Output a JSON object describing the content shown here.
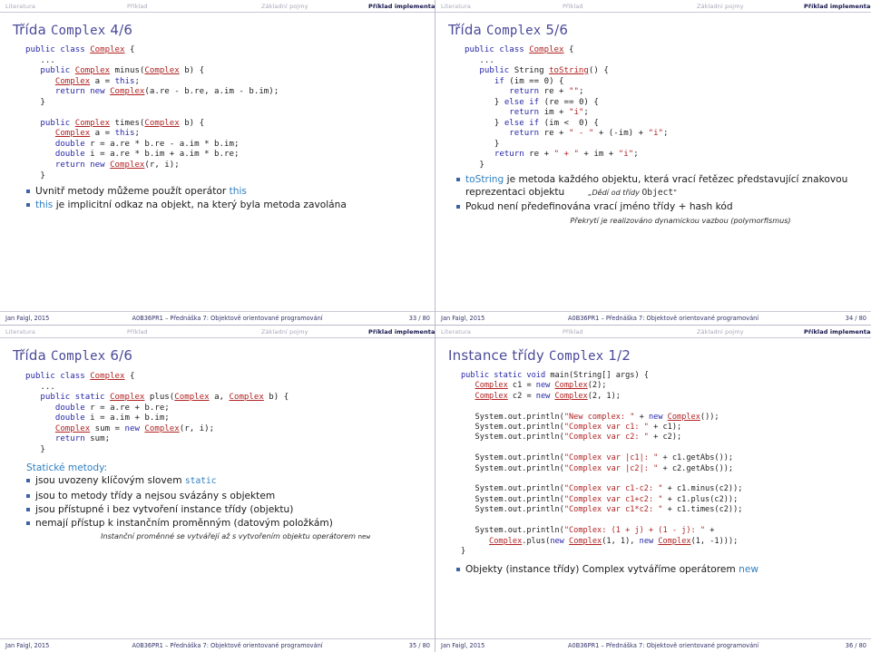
{
  "theme": {
    "title_color": "#4a4a99",
    "nav_inactive": "#a8a8bb",
    "nav_active": "#11114a",
    "keyword_color": "#2727a8",
    "class_color": "#b22222",
    "string_color": "#b22222",
    "bullet_color": "#3c63a8",
    "highlight_color": "#2f7fc1",
    "footer_color": "#33336b"
  },
  "nav": {
    "items": [
      {
        "label": "Literatura",
        "active": false
      },
      {
        "label": "Příklad",
        "active": false
      },
      {
        "label": "Základní pojmy",
        "active": false
      },
      {
        "label": "Příklad implementace",
        "active": true
      }
    ]
  },
  "footer_common": {
    "author": "Jan Faigl, 2015",
    "center": "A0B36PR1 – Přednáška 7: Objektově orientované programování"
  },
  "slides": [
    {
      "id": "slide-33",
      "title_text": "Třída ",
      "title_mono": "Complex",
      "title_suffix": " 4/6",
      "page": "33 / 80",
      "bullets": [
        {
          "pre": "Uvnitř metody můžeme použít operátor ",
          "hl": "this",
          "post": ""
        },
        {
          "pre": "",
          "hl": "this",
          "post": " je implicitní odkaz na objekt, na který byla metoda zavolána"
        }
      ]
    },
    {
      "id": "slide-34",
      "title_text": "Třída ",
      "title_mono": "Complex",
      "title_suffix": " 5/6",
      "page": "34 / 80",
      "bullets": [
        {
          "pre": "",
          "hl": "toString",
          "post": " je metoda každého objektu, která vrací řetězec představující znakovou reprezentaci objektu"
        },
        {
          "pre": "Pokud není předefinována vrací jméno třídy + hash kód",
          "hl": "",
          "post": ""
        }
      ],
      "side_note_text": "„Dědí od třídy ",
      "side_note_mono": "Object",
      "side_note_suffix": "\"",
      "bottom_note": "Překrytí je realizováno dynamickou vazbou (polymorfismus)"
    },
    {
      "id": "slide-35",
      "title_text": "Třída ",
      "title_mono": "Complex",
      "title_suffix": " 6/6",
      "page": "35 / 80",
      "lead": "Statické metody:",
      "bullets": [
        {
          "pre": "jsou uvozeny klíčovým slovem ",
          "hl": "static",
          "post": ""
        },
        {
          "pre": "jsou to metody třídy a nejsou svázány s objektem",
          "hl": "",
          "post": ""
        },
        {
          "pre": "jsou přístupné i bez vytvoření instance třídy (objektu)",
          "hl": "",
          "post": ""
        },
        {
          "pre": "nemají přístup k instančním proměnným (datovým položkám)",
          "hl": "",
          "post": ""
        }
      ],
      "bottom_note_text": "Instanční proměnné se vytvářejí až s vytvořením objektu operátorem ",
      "bottom_note_mono": "new"
    },
    {
      "id": "slide-36",
      "title_text": "Instance třídy ",
      "title_mono": "Complex",
      "title_suffix": " 1/2",
      "page": "36 / 80",
      "bullets": [
        {
          "pre": "Objekty (instance třídy) Complex vytváříme operátorem ",
          "hl": "new",
          "post": ""
        }
      ]
    }
  ],
  "code": {
    "slide33": [
      {
        "t": "public class ",
        "c": "kw"
      },
      {
        "t": "Complex",
        "c": "cls"
      },
      {
        "t": " {\n",
        "c": ""
      },
      {
        "t": "   ...\n",
        "c": ""
      },
      {
        "t": "   public ",
        "c": "kw"
      },
      {
        "t": "Complex",
        "c": "cls"
      },
      {
        "t": " minus(",
        "c": ""
      },
      {
        "t": "Complex",
        "c": "cls"
      },
      {
        "t": " b) {\n",
        "c": ""
      },
      {
        "t": "      ",
        "c": ""
      },
      {
        "t": "Complex",
        "c": "cls"
      },
      {
        "t": " a = ",
        "c": ""
      },
      {
        "t": "this",
        "c": "kw"
      },
      {
        "t": ";\n",
        "c": ""
      },
      {
        "t": "      return new ",
        "c": "kw"
      },
      {
        "t": "Complex",
        "c": "cls"
      },
      {
        "t": "(a.re - b.re, a.im - b.im);\n",
        "c": ""
      },
      {
        "t": "   }\n\n",
        "c": ""
      },
      {
        "t": "   public ",
        "c": "kw"
      },
      {
        "t": "Complex",
        "c": "cls"
      },
      {
        "t": " times(",
        "c": ""
      },
      {
        "t": "Complex",
        "c": "cls"
      },
      {
        "t": " b) {\n",
        "c": ""
      },
      {
        "t": "      ",
        "c": ""
      },
      {
        "t": "Complex",
        "c": "cls"
      },
      {
        "t": " a = ",
        "c": ""
      },
      {
        "t": "this",
        "c": "kw"
      },
      {
        "t": ";\n",
        "c": ""
      },
      {
        "t": "      double",
        "c": "kw"
      },
      {
        "t": " r = a.re * b.re - a.im * b.im;\n",
        "c": ""
      },
      {
        "t": "      double",
        "c": "kw"
      },
      {
        "t": " i = a.re * b.im + a.im * b.re;\n",
        "c": ""
      },
      {
        "t": "      return new ",
        "c": "kw"
      },
      {
        "t": "Complex",
        "c": "cls"
      },
      {
        "t": "(r, i);\n",
        "c": ""
      },
      {
        "t": "   }",
        "c": ""
      }
    ],
    "slide34": [
      {
        "t": "public class ",
        "c": "kw"
      },
      {
        "t": "Complex",
        "c": "cls"
      },
      {
        "t": " {\n",
        "c": ""
      },
      {
        "t": "   ...\n",
        "c": ""
      },
      {
        "t": "   public ",
        "c": "kw"
      },
      {
        "t": "String ",
        "c": ""
      },
      {
        "t": "toString",
        "c": "cls"
      },
      {
        "t": "() {\n",
        "c": ""
      },
      {
        "t": "      if",
        "c": "kw"
      },
      {
        "t": " (im == 0) {\n",
        "c": ""
      },
      {
        "t": "         return",
        "c": "kw"
      },
      {
        "t": " re + ",
        "c": ""
      },
      {
        "t": "\"\"",
        "c": "str"
      },
      {
        "t": ";\n",
        "c": ""
      },
      {
        "t": "      } ",
        "c": ""
      },
      {
        "t": "else if",
        "c": "kw"
      },
      {
        "t": " (re == 0) {\n",
        "c": ""
      },
      {
        "t": "         return",
        "c": "kw"
      },
      {
        "t": " im + ",
        "c": ""
      },
      {
        "t": "\"i\"",
        "c": "str"
      },
      {
        "t": ";\n",
        "c": ""
      },
      {
        "t": "      } ",
        "c": ""
      },
      {
        "t": "else if",
        "c": "kw"
      },
      {
        "t": " (im <  0) {\n",
        "c": ""
      },
      {
        "t": "         return",
        "c": "kw"
      },
      {
        "t": " re + ",
        "c": ""
      },
      {
        "t": "\" - \"",
        "c": "str"
      },
      {
        "t": " + (-im) + ",
        "c": ""
      },
      {
        "t": "\"i\"",
        "c": "str"
      },
      {
        "t": ";\n",
        "c": ""
      },
      {
        "t": "      }\n",
        "c": ""
      },
      {
        "t": "      return",
        "c": "kw"
      },
      {
        "t": " re + ",
        "c": ""
      },
      {
        "t": "\" + \"",
        "c": "str"
      },
      {
        "t": " + im + ",
        "c": ""
      },
      {
        "t": "\"i\"",
        "c": "str"
      },
      {
        "t": ";\n",
        "c": ""
      },
      {
        "t": "   }",
        "c": ""
      }
    ],
    "slide35": [
      {
        "t": "public class ",
        "c": "kw"
      },
      {
        "t": "Complex",
        "c": "cls"
      },
      {
        "t": " {\n",
        "c": ""
      },
      {
        "t": "   ...\n",
        "c": ""
      },
      {
        "t": "   public static ",
        "c": "kw"
      },
      {
        "t": "Complex",
        "c": "cls"
      },
      {
        "t": " plus(",
        "c": ""
      },
      {
        "t": "Complex",
        "c": "cls"
      },
      {
        "t": " a, ",
        "c": ""
      },
      {
        "t": "Complex",
        "c": "cls"
      },
      {
        "t": " b) {\n",
        "c": ""
      },
      {
        "t": "      double",
        "c": "kw"
      },
      {
        "t": " r = a.re + b.re;\n",
        "c": ""
      },
      {
        "t": "      double",
        "c": "kw"
      },
      {
        "t": " i = a.im + b.im;\n",
        "c": ""
      },
      {
        "t": "      ",
        "c": ""
      },
      {
        "t": "Complex",
        "c": "cls"
      },
      {
        "t": " sum = ",
        "c": ""
      },
      {
        "t": "new ",
        "c": "kw"
      },
      {
        "t": "Complex",
        "c": "cls"
      },
      {
        "t": "(r, i);\n",
        "c": ""
      },
      {
        "t": "      return",
        "c": "kw"
      },
      {
        "t": " sum;\n",
        "c": ""
      },
      {
        "t": "   }",
        "c": ""
      }
    ],
    "slide36": [
      {
        "t": "public static void ",
        "c": "kw"
      },
      {
        "t": "main(String[] args) {\n",
        "c": ""
      },
      {
        "t": "   ",
        "c": ""
      },
      {
        "t": "Complex",
        "c": "cls"
      },
      {
        "t": " c1 = ",
        "c": ""
      },
      {
        "t": "new ",
        "c": "kw"
      },
      {
        "t": "Complex",
        "c": "cls"
      },
      {
        "t": "(2);\n",
        "c": ""
      },
      {
        "t": "   ",
        "c": ""
      },
      {
        "t": "Complex",
        "c": "cls"
      },
      {
        "t": " c2 = ",
        "c": ""
      },
      {
        "t": "new ",
        "c": "kw"
      },
      {
        "t": "Complex",
        "c": "cls"
      },
      {
        "t": "(2, 1);\n\n",
        "c": ""
      },
      {
        "t": "   System.out.println(",
        "c": ""
      },
      {
        "t": "\"New complex: \"",
        "c": "str"
      },
      {
        "t": " + ",
        "c": ""
      },
      {
        "t": "new ",
        "c": "kw"
      },
      {
        "t": "Complex",
        "c": "cls"
      },
      {
        "t": "());\n",
        "c": ""
      },
      {
        "t": "   System.out.println(",
        "c": ""
      },
      {
        "t": "\"Complex var c1: \"",
        "c": "str"
      },
      {
        "t": " + c1);\n",
        "c": ""
      },
      {
        "t": "   System.out.println(",
        "c": ""
      },
      {
        "t": "\"Complex var c2: \"",
        "c": "str"
      },
      {
        "t": " + c2);\n\n",
        "c": ""
      },
      {
        "t": "   System.out.println(",
        "c": ""
      },
      {
        "t": "\"Complex var |c1|: \"",
        "c": "str"
      },
      {
        "t": " + c1.getAbs());\n",
        "c": ""
      },
      {
        "t": "   System.out.println(",
        "c": ""
      },
      {
        "t": "\"Complex var |c2|: \"",
        "c": "str"
      },
      {
        "t": " + c2.getAbs());\n\n",
        "c": ""
      },
      {
        "t": "   System.out.println(",
        "c": ""
      },
      {
        "t": "\"Complex var c1-c2: \"",
        "c": "str"
      },
      {
        "t": " + c1.minus(c2));\n",
        "c": ""
      },
      {
        "t": "   System.out.println(",
        "c": ""
      },
      {
        "t": "\"Complex var c1+c2: \"",
        "c": "str"
      },
      {
        "t": " + c1.plus(c2));\n",
        "c": ""
      },
      {
        "t": "   System.out.println(",
        "c": ""
      },
      {
        "t": "\"Complex var c1*c2: \"",
        "c": "str"
      },
      {
        "t": " + c1.times(c2));\n\n",
        "c": ""
      },
      {
        "t": "   System.out.println(",
        "c": ""
      },
      {
        "t": "\"Complex: (1 + j) + (1 - j): \"",
        "c": "str"
      },
      {
        "t": " +\n",
        "c": ""
      },
      {
        "t": "      ",
        "c": ""
      },
      {
        "t": "Complex",
        "c": "cls"
      },
      {
        "t": ".plus(",
        "c": ""
      },
      {
        "t": "new ",
        "c": "kw"
      },
      {
        "t": "Complex",
        "c": "cls"
      },
      {
        "t": "(1, 1), ",
        "c": ""
      },
      {
        "t": "new ",
        "c": "kw"
      },
      {
        "t": "Complex",
        "c": "cls"
      },
      {
        "t": "(1, -1)));\n",
        "c": ""
      },
      {
        "t": "}",
        "c": ""
      }
    ]
  }
}
